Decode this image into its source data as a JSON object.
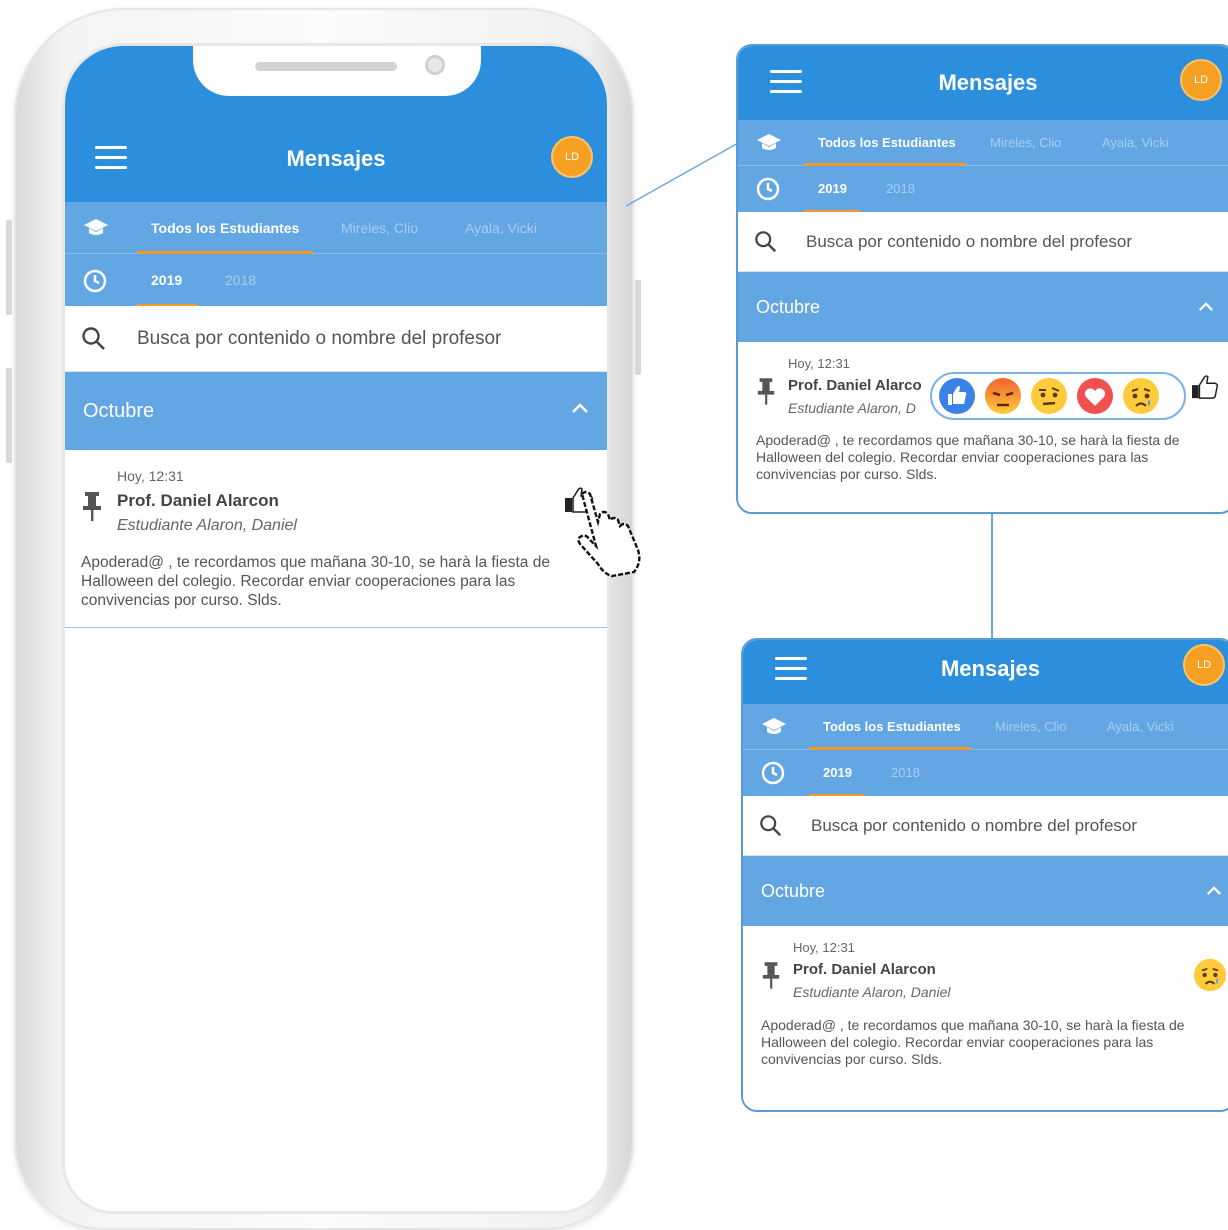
{
  "app": {
    "title": "Mensajes",
    "avatar_initials": "LD",
    "student_tabs": [
      "Todos los Estudiantes",
      "Mireles, Clio",
      "Ayala, Vicki"
    ],
    "active_student_tab": "Todos los Estudiantes",
    "year_tabs": [
      "2019",
      "2018"
    ],
    "active_year": "2019",
    "search_placeholder": "Busca por contenido o nombre del profesor",
    "month": "Octubre",
    "message": {
      "time": "Hoy, 12:31",
      "teacher": "Prof. Daniel Alarcon",
      "teacher_truncated": "Prof. Daniel Alarco",
      "student": "Estudiante Alaron, Daniel",
      "student_truncated": "Estudiante Alaron, D",
      "body": "Apoderad@ , te recordamos que mañana 30-10, se harà la fiesta de Halloween del colegio. Recordar enviar cooperaciones para las convivencias por curso. Slds."
    }
  },
  "reactions": [
    "like",
    "angry",
    "meh",
    "love",
    "sad"
  ],
  "selected_reaction": "sad",
  "colors": {
    "header_blue": "#2c8fde",
    "tab_blue": "#62a6e4",
    "accent_orange": "#f59a2a",
    "avatar_orange": "#f5a023",
    "like_blue": "#3b82e6",
    "emoji_yellow": "#ffcb3a",
    "angry_red": "#f2612f",
    "love_red": "#f0504f"
  },
  "icons": [
    "menu-icon",
    "graduation-cap-icon",
    "clock-icon",
    "search-icon",
    "chevron-up-icon",
    "pin-icon",
    "thumbs-up-icon",
    "hand-pointer-icon"
  ]
}
